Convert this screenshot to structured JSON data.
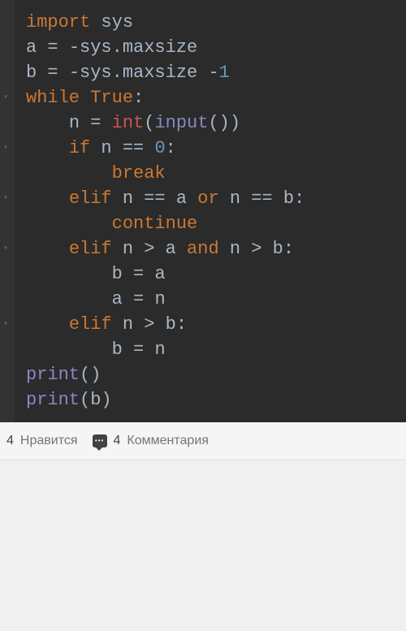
{
  "code": {
    "lines": [
      {
        "tokens": [
          {
            "t": "import ",
            "c": "kw-import"
          },
          {
            "t": "sys",
            "c": "var"
          }
        ]
      },
      {
        "tokens": [
          {
            "t": "a ",
            "c": "var"
          },
          {
            "t": "= ",
            "c": "op"
          },
          {
            "t": "-",
            "c": "op"
          },
          {
            "t": "sys.maxsize",
            "c": "var"
          }
        ]
      },
      {
        "tokens": [
          {
            "t": "b ",
            "c": "var"
          },
          {
            "t": "= ",
            "c": "op"
          },
          {
            "t": "-",
            "c": "op"
          },
          {
            "t": "sys.maxsize ",
            "c": "var"
          },
          {
            "t": "-",
            "c": "op"
          },
          {
            "t": "1",
            "c": "num"
          }
        ]
      },
      {
        "tokens": [
          {
            "t": "while ",
            "c": "kw-while"
          },
          {
            "t": "True",
            "c": "kw-true"
          },
          {
            "t": ":",
            "c": "op"
          }
        ],
        "fold": true
      },
      {
        "tokens": [
          {
            "t": "    ",
            "c": "indent"
          },
          {
            "t": "n ",
            "c": "var"
          },
          {
            "t": "= ",
            "c": "op"
          },
          {
            "t": "int",
            "c": "func-int"
          },
          {
            "t": "(",
            "c": "op"
          },
          {
            "t": "input",
            "c": "builtin"
          },
          {
            "t": "())",
            "c": "op"
          }
        ]
      },
      {
        "tokens": [
          {
            "t": "    ",
            "c": "indent"
          },
          {
            "t": "if ",
            "c": "kw-if"
          },
          {
            "t": "n ",
            "c": "var"
          },
          {
            "t": "== ",
            "c": "op"
          },
          {
            "t": "0",
            "c": "num"
          },
          {
            "t": ":",
            "c": "op"
          }
        ],
        "fold": true
      },
      {
        "tokens": [
          {
            "t": "        ",
            "c": "indent"
          },
          {
            "t": "break",
            "c": "kw-break"
          }
        ]
      },
      {
        "tokens": [
          {
            "t": "    ",
            "c": "indent"
          },
          {
            "t": "elif ",
            "c": "kw-elif"
          },
          {
            "t": "n ",
            "c": "var"
          },
          {
            "t": "== ",
            "c": "op"
          },
          {
            "t": "a ",
            "c": "var"
          },
          {
            "t": "or ",
            "c": "kw-or"
          },
          {
            "t": "n ",
            "c": "var"
          },
          {
            "t": "== ",
            "c": "op"
          },
          {
            "t": "b",
            "c": "var"
          },
          {
            "t": ":",
            "c": "op"
          }
        ],
        "fold": true
      },
      {
        "tokens": [
          {
            "t": "        ",
            "c": "indent"
          },
          {
            "t": "continue",
            "c": "kw-continue"
          }
        ]
      },
      {
        "tokens": [
          {
            "t": "    ",
            "c": "indent"
          },
          {
            "t": "elif ",
            "c": "kw-elif"
          },
          {
            "t": "n ",
            "c": "var"
          },
          {
            "t": "> ",
            "c": "op"
          },
          {
            "t": "a ",
            "c": "var"
          },
          {
            "t": "and ",
            "c": "kw-and"
          },
          {
            "t": "n ",
            "c": "var"
          },
          {
            "t": "> ",
            "c": "op"
          },
          {
            "t": "b",
            "c": "var"
          },
          {
            "t": ":",
            "c": "op"
          }
        ],
        "fold": true
      },
      {
        "tokens": [
          {
            "t": "        ",
            "c": "indent"
          },
          {
            "t": "b ",
            "c": "var"
          },
          {
            "t": "= ",
            "c": "op"
          },
          {
            "t": "a",
            "c": "var"
          }
        ]
      },
      {
        "tokens": [
          {
            "t": "        ",
            "c": "indent"
          },
          {
            "t": "a ",
            "c": "var"
          },
          {
            "t": "= ",
            "c": "op"
          },
          {
            "t": "n",
            "c": "var"
          }
        ]
      },
      {
        "tokens": [
          {
            "t": "    ",
            "c": "indent"
          },
          {
            "t": "elif ",
            "c": "kw-elif"
          },
          {
            "t": "n ",
            "c": "var"
          },
          {
            "t": "> ",
            "c": "op"
          },
          {
            "t": "b",
            "c": "var"
          },
          {
            "t": ":",
            "c": "op"
          }
        ],
        "fold": true
      },
      {
        "tokens": [
          {
            "t": "        ",
            "c": "indent"
          },
          {
            "t": "b ",
            "c": "var"
          },
          {
            "t": "= ",
            "c": "op"
          },
          {
            "t": "n",
            "c": "var"
          }
        ]
      },
      {
        "tokens": [
          {
            "t": "print",
            "c": "builtin"
          },
          {
            "t": "()",
            "c": "op"
          }
        ]
      },
      {
        "tokens": [
          {
            "t": "print",
            "c": "builtin"
          },
          {
            "t": "(",
            "c": "op"
          },
          {
            "t": "b",
            "c": "var"
          },
          {
            "t": ")",
            "c": "op"
          }
        ]
      }
    ]
  },
  "social": {
    "like_count": "4",
    "like_label": "Нравится",
    "comment_count": "4",
    "comment_label": "Комментария"
  }
}
